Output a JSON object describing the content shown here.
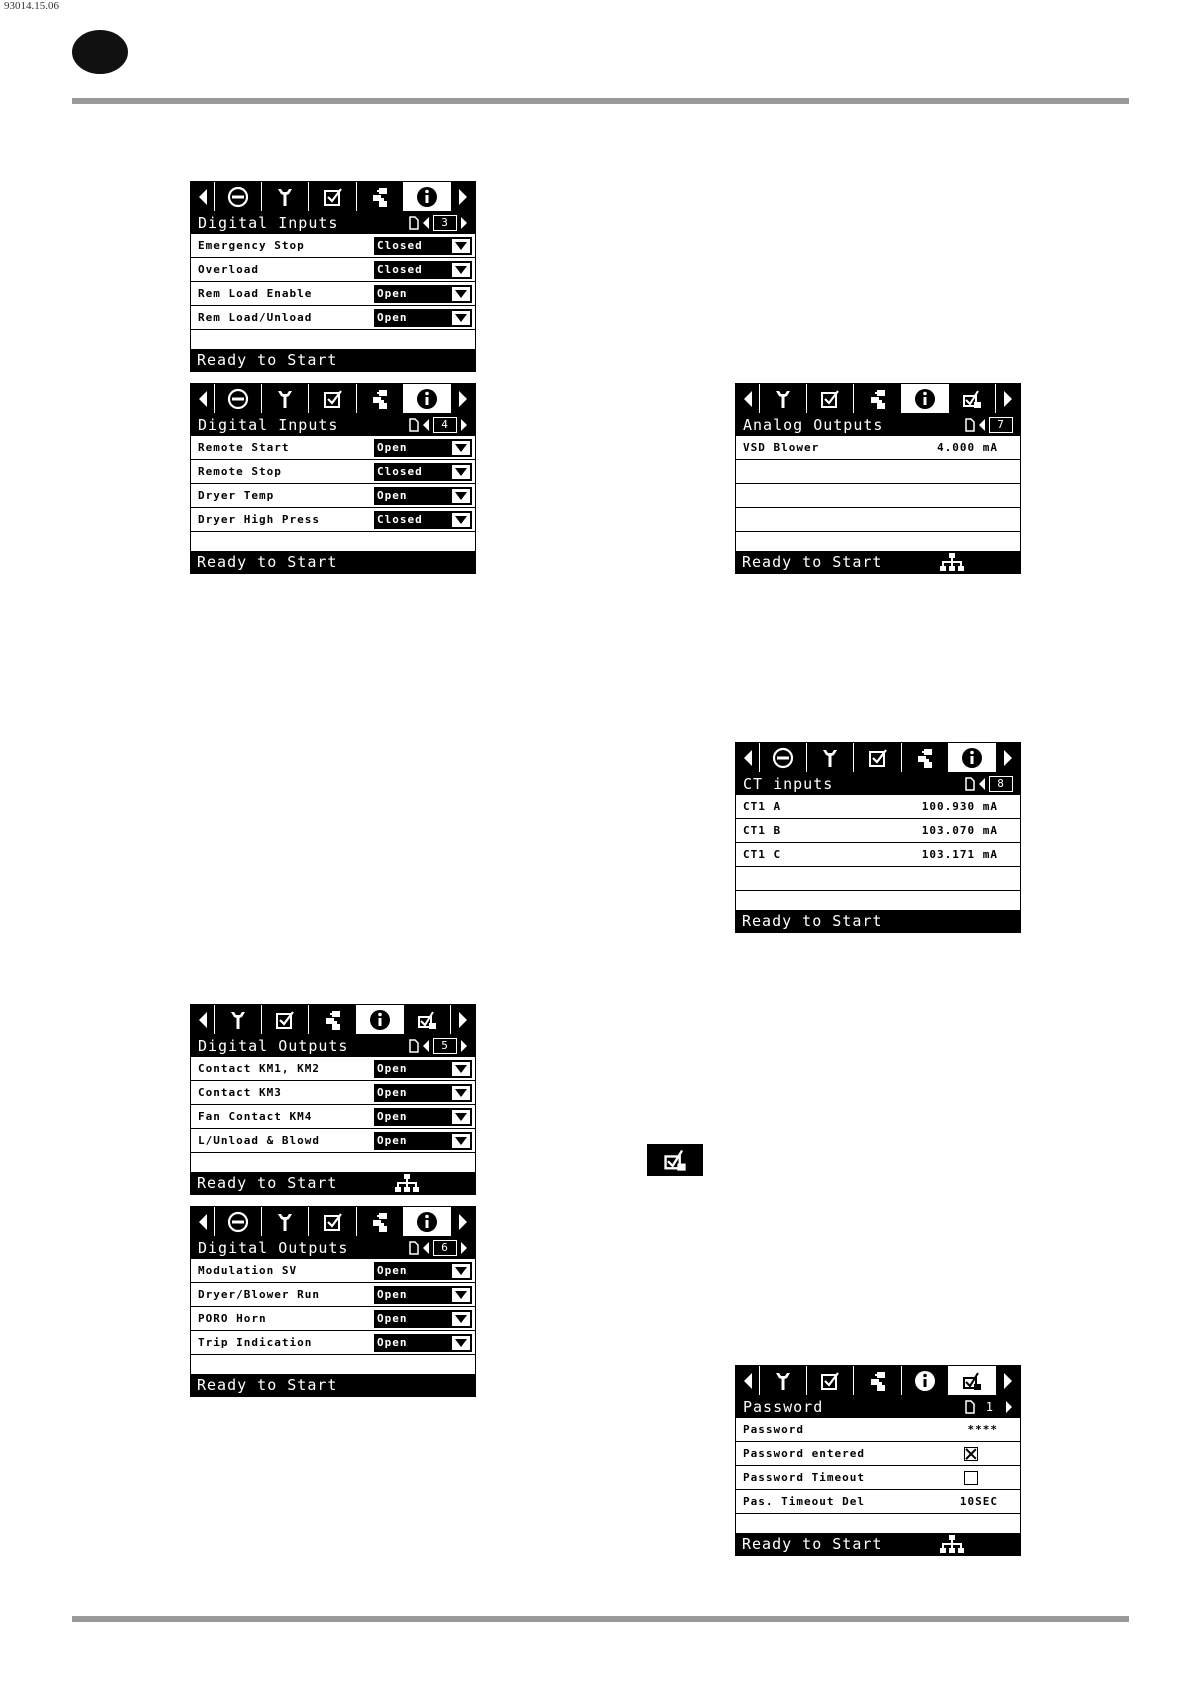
{
  "header": {
    "doc_code": "93014.15.06"
  },
  "screens": {
    "di3": {
      "title": "Digital Inputs",
      "page": "3",
      "status": "Ready to Start",
      "rows": [
        {
          "label": "Emergency Stop",
          "value": "Closed"
        },
        {
          "label": "Overload",
          "value": "Closed"
        },
        {
          "label": "Rem Load Enable",
          "value": "Open"
        },
        {
          "label": "Rem Load/Unload",
          "value": "Open"
        }
      ]
    },
    "di4": {
      "title": "Digital Inputs",
      "page": "4",
      "status": "Ready to Start",
      "rows": [
        {
          "label": "Remote Start",
          "value": "Open"
        },
        {
          "label": "Remote Stop",
          "value": "Closed"
        },
        {
          "label": "Dryer Temp",
          "value": "Open"
        },
        {
          "label": "Dryer High Press",
          "value": "Closed"
        }
      ]
    },
    "ao7": {
      "title": "Analog Outputs",
      "page": "7",
      "status": "Ready to Start",
      "rows": [
        {
          "label": "VSD Blower",
          "value": "4.000 mA"
        }
      ]
    },
    "ct8": {
      "title": "CT inputs",
      "page": "8",
      "status": "Ready to Start",
      "rows": [
        {
          "label": "CT1 A",
          "value": "100.930 mA"
        },
        {
          "label": "CT1 B",
          "value": "103.070 mA"
        },
        {
          "label": "CT1 C",
          "value": "103.171 mA"
        }
      ]
    },
    "do5": {
      "title": "Digital Outputs",
      "page": "5",
      "status": "Ready to Start",
      "rows": [
        {
          "label": "Contact KM1, KM2",
          "value": "Open"
        },
        {
          "label": "Contact KM3",
          "value": "Open"
        },
        {
          "label": "Fan Contact KM4",
          "value": "Open"
        },
        {
          "label": "L/Unload & Blowd",
          "value": "Open"
        }
      ]
    },
    "do6": {
      "title": "Digital Outputs",
      "page": "6",
      "status": "Ready to Start",
      "rows": [
        {
          "label": "Modulation SV",
          "value": "Open"
        },
        {
          "label": "Dryer/Blower Run",
          "value": "Open"
        },
        {
          "label": "PORO Horn",
          "value": "Open"
        },
        {
          "label": "Trip Indication",
          "value": "Open"
        }
      ]
    },
    "pw": {
      "title": "Password",
      "page": "1",
      "status": "Ready to Start",
      "rows": [
        {
          "label": "Password",
          "value": "****"
        },
        {
          "label": "Password entered"
        },
        {
          "label": "Password Timeout"
        },
        {
          "label": "Pas. Timeout Del",
          "value": "10SEC"
        }
      ]
    }
  }
}
